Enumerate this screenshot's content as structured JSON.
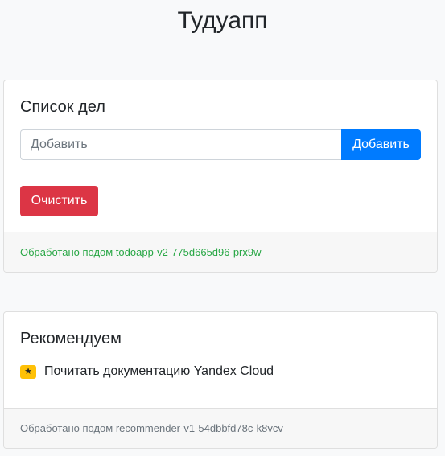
{
  "app": {
    "title": "Тудуапп"
  },
  "todo": {
    "title": "Список дел",
    "input": {
      "placeholder": "Добавить",
      "value": ""
    },
    "add_label": "Добавить",
    "clear_label": "Очистить",
    "footer": "Обработано подом todoapp-v2-775d665d96-prx9w"
  },
  "recommend": {
    "title": "Рекомендуем",
    "items": [
      {
        "icon": "star-icon",
        "text": "Почитать документацию Yandex Cloud"
      }
    ],
    "footer": "Обработано подом recommender-v1-54dbbfd78c-k8vcv"
  },
  "colors": {
    "primary": "#007bff",
    "danger": "#dc3545",
    "success": "#28a745",
    "warning": "#ffc107",
    "muted": "#6c757d"
  }
}
